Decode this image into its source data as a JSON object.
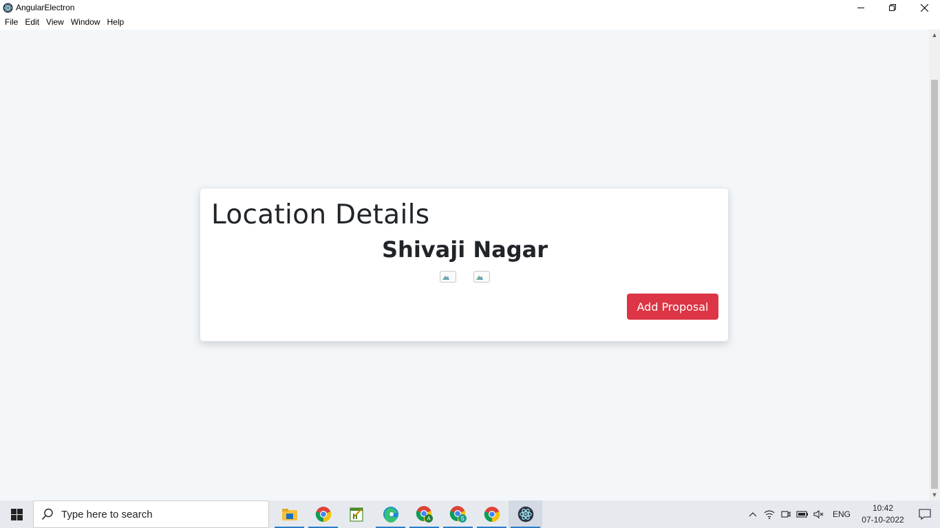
{
  "window": {
    "title": "AngularElectron",
    "controls": [
      "minimize-icon",
      "restore-icon",
      "close-icon"
    ]
  },
  "menu": {
    "items": [
      "File",
      "Edit",
      "View",
      "Window",
      "Help"
    ]
  },
  "card": {
    "title": "Location Details",
    "subtitle": "Shivaji Nagar",
    "images": [
      "broken-image-icon",
      "broken-image-icon"
    ],
    "add_button": "Add Proposal",
    "add_button_color": "#dc3545"
  },
  "taskbar": {
    "search_placeholder": "Type here to search",
    "apps": [
      "file-explorer-icon",
      "chrome-icon",
      "notes-app-icon",
      "edge-icon",
      "chrome-profile-a-icon",
      "chrome-profile-s-icon",
      "chrome-icon",
      "electron-icon"
    ],
    "language": "ENG",
    "time": "10:42",
    "date": "07-10-2022"
  }
}
